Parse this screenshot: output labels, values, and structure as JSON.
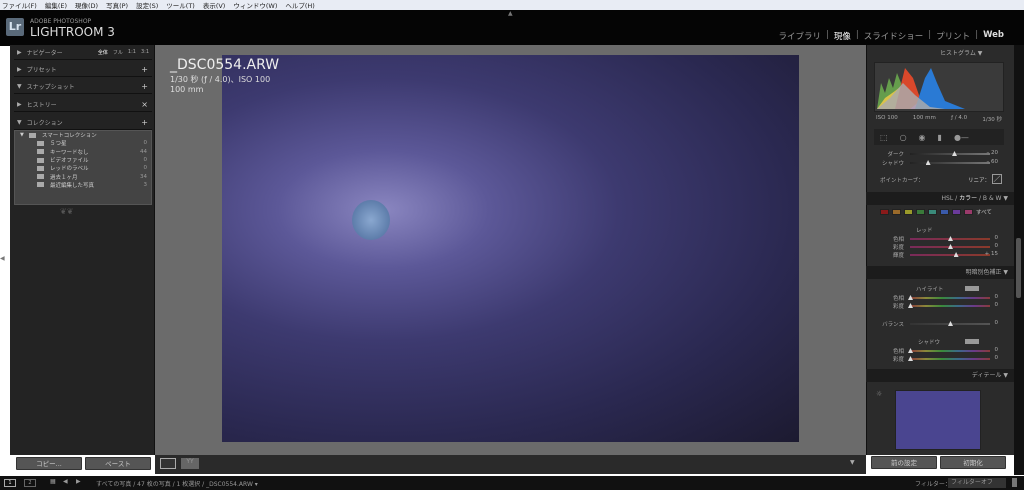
{
  "menu": [
    "ファイル(F)",
    "編集(E)",
    "現像(D)",
    "写真(P)",
    "設定(S)",
    "ツール(T)",
    "表示(V)",
    "ウィンドウ(W)",
    "ヘルプ(H)"
  ],
  "brand": {
    "logo": "Lr",
    "small": "ADOBE PHOTOSHOP",
    "big": "LIGHTROOM 3"
  },
  "modules": [
    "ライブラリ",
    "現像",
    "スライドショー",
    "プリント",
    "Web"
  ],
  "left": {
    "navigator": "ナビゲーター",
    "nav_opts": [
      "全体",
      "フル",
      "1:1",
      "3:1"
    ],
    "presets": "プリセット",
    "snapshots": "スナップショット",
    "history": "ヒストリー",
    "collections": "コレクション",
    "smart": "スマートコレクション",
    "items": [
      {
        "name": "５つ星",
        "count": "0"
      },
      {
        "name": "キーワードなし",
        "count": "44"
      },
      {
        "name": "ビデオファイル",
        "count": "0"
      },
      {
        "name": "レッドのラベル",
        "count": "0"
      },
      {
        "name": "過去１ヶ月",
        "count": "34"
      },
      {
        "name": "最近編集した写真",
        "count": "3"
      }
    ],
    "copy": "コピー...",
    "paste": "ペースト"
  },
  "photo": {
    "filename": "_DSC0554.ARW",
    "exif1": "1/30 秒 (ƒ / 4.0)、ISO 100",
    "exif2": "100 mm"
  },
  "right": {
    "histogram": "ヒストグラム",
    "hist_info": [
      "ISO 100",
      "100 mm",
      "ƒ / 4.0",
      "1/30 秒"
    ],
    "tone": [
      {
        "label": "ダーク",
        "value": "– 20",
        "pos": 0.55
      },
      {
        "label": "シャドウ",
        "value": "– 60",
        "pos": 0.22
      }
    ],
    "pointcurve": "ポイントカーブ：",
    "curve_val": "リニア：",
    "hsl_tabs": [
      "HSL",
      "カラー",
      "B & W"
    ],
    "all": "すべて",
    "swatches": [
      "#8a1a1a",
      "#9a6a2a",
      "#9a9a2a",
      "#3a7a3a",
      "#3a8a7a",
      "#3a5aaa",
      "#6a3a9a",
      "#9a3a6a"
    ],
    "red": "レッド",
    "red_sliders": [
      {
        "label": "色相",
        "value": "0",
        "pos": 0.5
      },
      {
        "label": "彩度",
        "value": "0",
        "pos": 0.5
      },
      {
        "label": "輝度",
        "value": "+ 15",
        "pos": 0.57
      }
    ],
    "split": "明暗別色補正",
    "highlight": "ハイライト",
    "hl_sliders": [
      {
        "label": "色相",
        "value": "0",
        "pos": 0
      },
      {
        "label": "彩度",
        "value": "0",
        "pos": 0
      }
    ],
    "balance": {
      "label": "バランス",
      "value": "0",
      "pos": 0.5
    },
    "shadow": "シャドウ",
    "sh_sliders": [
      {
        "label": "色相",
        "value": "0",
        "pos": 0
      },
      {
        "label": "彩度",
        "value": "0",
        "pos": 0
      }
    ],
    "detail": "ディテール",
    "prev": "前の設定",
    "reset": "初期化"
  },
  "filmstrip": {
    "pages": [
      "1",
      "2"
    ],
    "path": "すべての写真 / 47 枚の写真 / 1 枚選択 / _DSC0554.ARW ▾",
    "filter_label": "フィルター：",
    "filter_value": "フィルターオフ"
  }
}
